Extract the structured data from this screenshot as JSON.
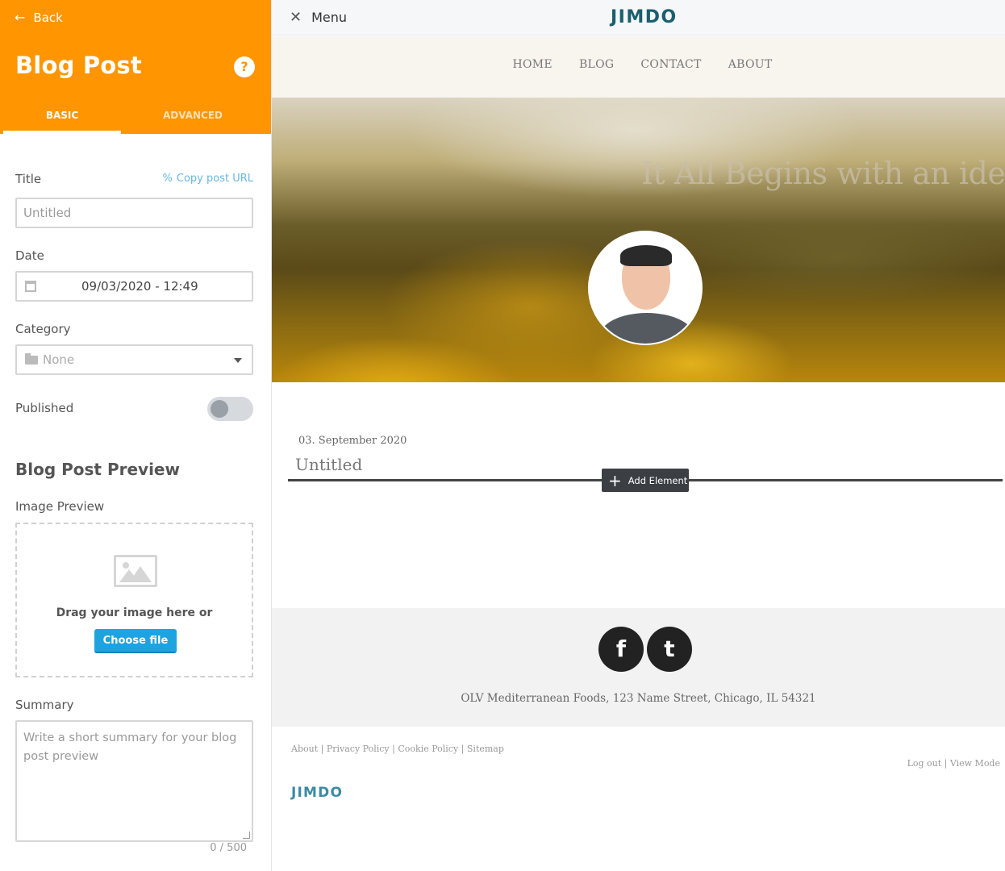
{
  "panel": {
    "back_label": "Back",
    "title": "Blog Post",
    "help_icon": "?",
    "tabs": [
      {
        "label": "BASIC"
      },
      {
        "label": "ADVANCED"
      }
    ],
    "title_label": "Title",
    "copy_url_label": "Copy post URL",
    "title_placeholder": "Untitled",
    "date_label": "Date",
    "date_value": "09/03/2020 - 12:49",
    "category_label": "Category",
    "category_value": "None",
    "published_label": "Published",
    "preview_title": "Blog Post Preview",
    "image_preview_label": "Image Preview",
    "drag_text": "Drag your image here or",
    "choose_file_label": "Choose file",
    "summary_label": "Summary",
    "summary_placeholder": "Write a short summary for your blog post preview",
    "summary_counter": "0 / 500"
  },
  "site": {
    "menu_label": "Menu",
    "logo": "JIMDO",
    "nav": [
      "HOME",
      "BLOG",
      "CONTACT",
      "ABOUT"
    ],
    "hero_title": "It All Begins with an idea.",
    "post_date": "03. September 2020",
    "post_title": "Untitled",
    "add_element_label": "Add Element",
    "address": "OLV Mediterranean Foods, 123 Name Street, Chicago, IL 54321",
    "legal_links": [
      "About",
      "Privacy Policy",
      "Cookie Policy",
      "Sitemap"
    ],
    "account_links": [
      "Log out",
      "View Mode"
    ],
    "footer_logo": "JIMDO"
  },
  "colors": {
    "accent": "#ff9500",
    "button_blue": "#1ea3e0",
    "logo_teal": "#1b5f6d"
  }
}
